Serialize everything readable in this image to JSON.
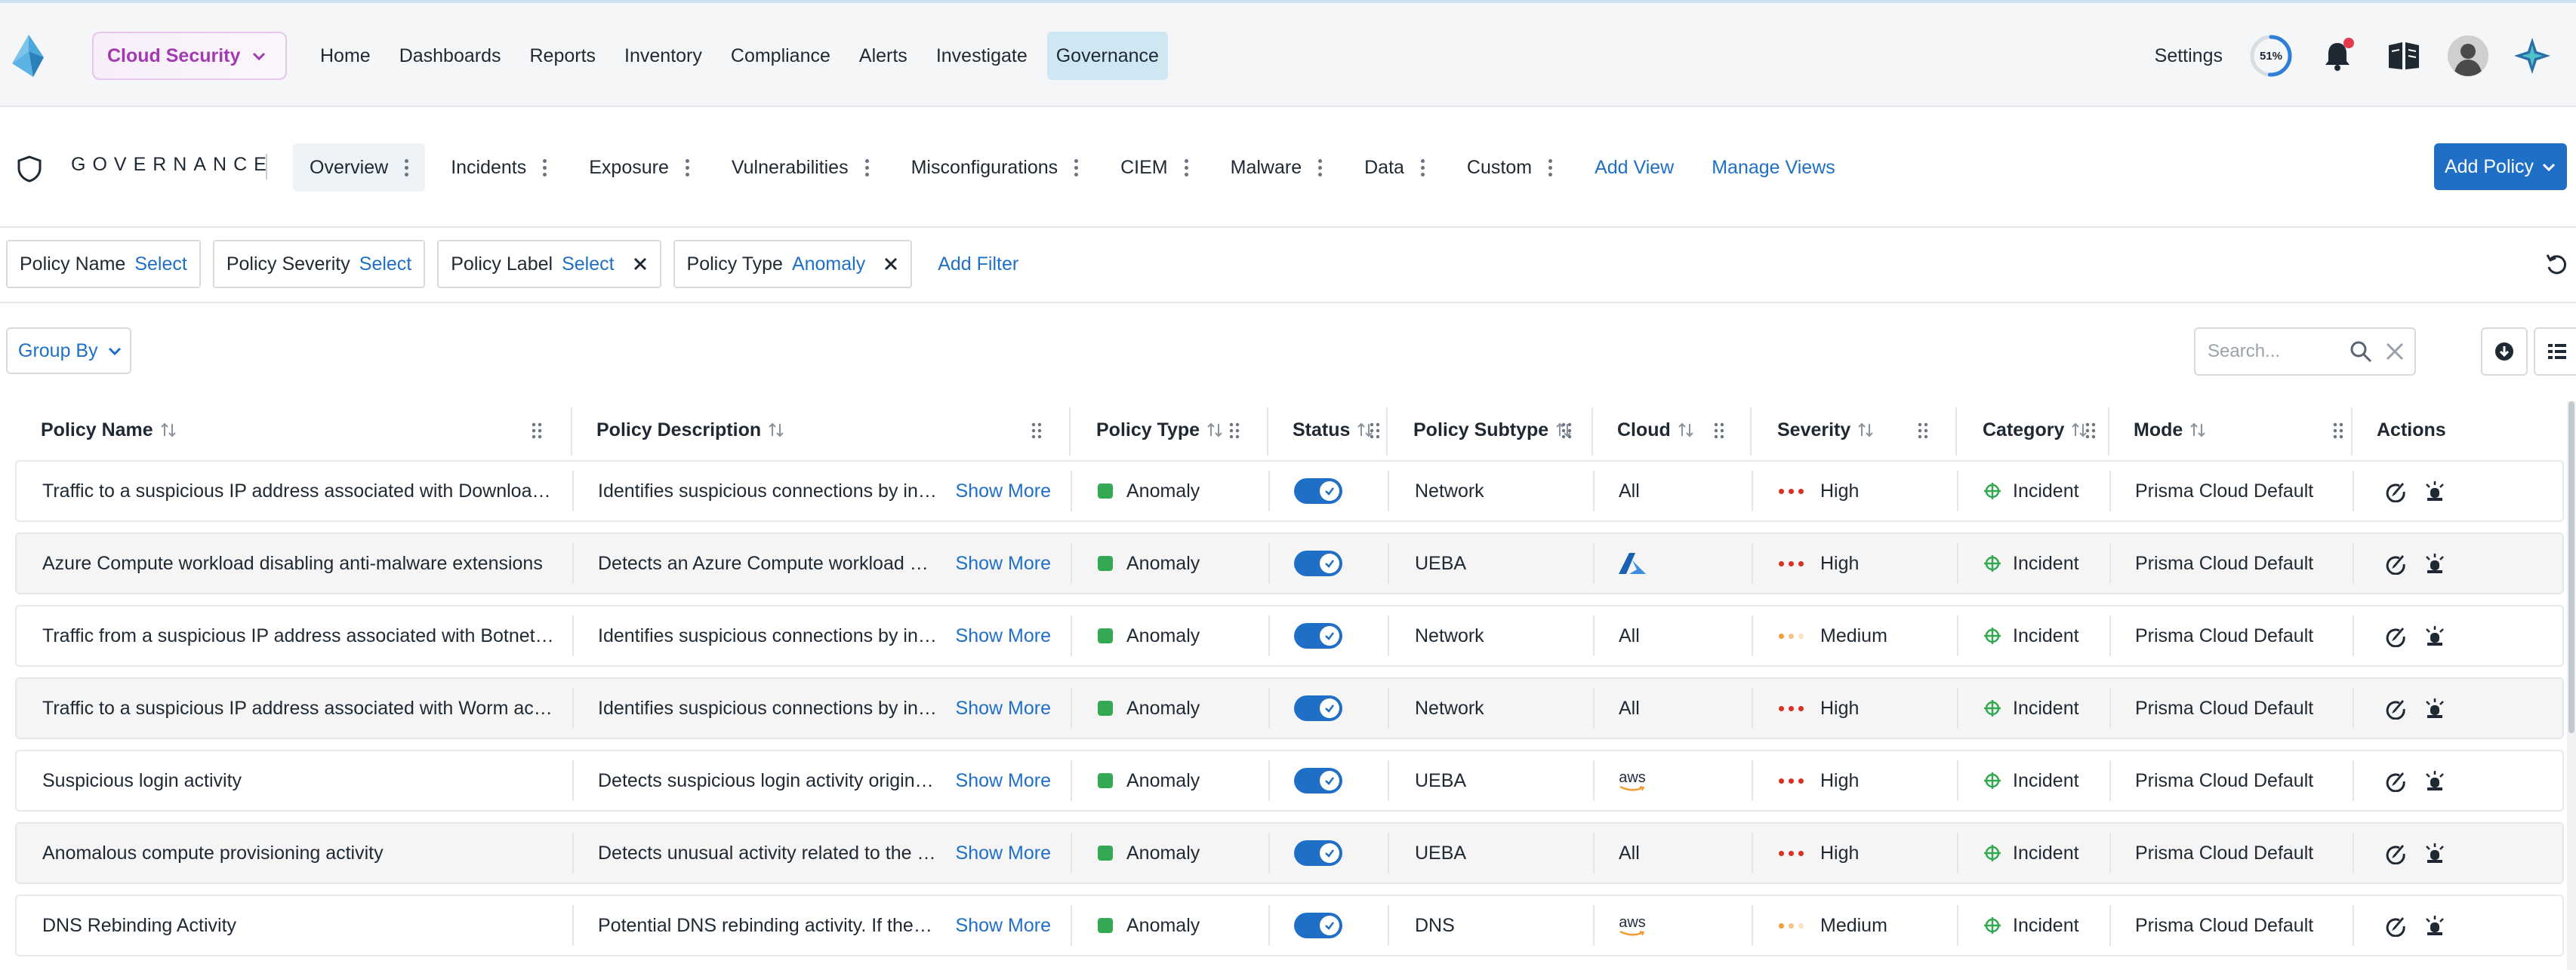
{
  "topnav": {
    "product": "Cloud Security",
    "links": [
      "Home",
      "Dashboards",
      "Reports",
      "Inventory",
      "Compliance",
      "Alerts",
      "Investigate",
      "Governance"
    ],
    "active_link": "Governance",
    "settings": "Settings",
    "progress_label": "51%",
    "progress_value": 0.51,
    "icons": [
      "bell-icon",
      "book-icon",
      "avatar",
      "assistant-icon"
    ]
  },
  "subnav": {
    "title": "GOVERNANCE",
    "tabs": [
      "Overview",
      "Incidents",
      "Exposure",
      "Vulnerabilities",
      "Misconfigurations",
      "CIEM",
      "Malware",
      "Data",
      "Custom"
    ],
    "active_tab": "Overview",
    "add_view": "Add View",
    "manage_views": "Manage Views",
    "add_policy": "Add Policy"
  },
  "filters": [
    {
      "label": "Policy Name",
      "value": "Select",
      "removable": false
    },
    {
      "label": "Policy Severity",
      "value": "Select",
      "removable": false
    },
    {
      "label": "Policy Label",
      "value": "Select",
      "removable": true
    },
    {
      "label": "Policy Type",
      "value": "Anomaly",
      "removable": true
    }
  ],
  "add_filter": "Add Filter",
  "toolbar": {
    "group_by": "Group By",
    "search_placeholder": "Search..."
  },
  "table": {
    "columns": [
      "Policy Name",
      "Policy Description",
      "Policy Type",
      "Status",
      "Policy Subtype",
      "Cloud",
      "Severity",
      "Category",
      "Mode",
      "Actions"
    ],
    "show_more": "Show More",
    "rows": [
      {
        "name": "Traffic to a suspicious IP address associated with Downloader ...",
        "description": "Identifies suspicious connections by inspe...",
        "type": "Anomaly",
        "enabled": true,
        "subtype": "Network",
        "cloud": "All",
        "cloud_icon": null,
        "severity": "High",
        "category": "Incident",
        "mode": "Prisma Cloud Default"
      },
      {
        "name": "Azure Compute workload disabling anti-malware extensions",
        "description": "Detects an Azure Compute workload disa...",
        "type": "Anomaly",
        "enabled": true,
        "subtype": "UEBA",
        "cloud": "",
        "cloud_icon": "azure-icon",
        "severity": "High",
        "category": "Incident",
        "mode": "Prisma Cloud Default"
      },
      {
        "name": "Traffic from a suspicious IP address associated with Botnet acti...",
        "description": "Identifies suspicious connections by inspe...",
        "type": "Anomaly",
        "enabled": true,
        "subtype": "Network",
        "cloud": "All",
        "cloud_icon": null,
        "severity": "Medium",
        "category": "Incident",
        "mode": "Prisma Cloud Default"
      },
      {
        "name": "Traffic to a suspicious IP address associated with Worm activity",
        "description": "Identifies suspicious connections by inspe...",
        "type": "Anomaly",
        "enabled": true,
        "subtype": "Network",
        "cloud": "All",
        "cloud_icon": null,
        "severity": "High",
        "category": "Incident",
        "mode": "Prisma Cloud Default"
      },
      {
        "name": "Suspicious login activity",
        "description": "Detects suspicious login activity originatin...",
        "type": "Anomaly",
        "enabled": true,
        "subtype": "UEBA",
        "cloud": "aws",
        "cloud_icon": "aws-icon",
        "severity": "High",
        "category": "Incident",
        "mode": "Prisma Cloud Default"
      },
      {
        "name": "Anomalous compute provisioning activity",
        "description": "Detects unusual activity related to the pro...",
        "type": "Anomaly",
        "enabled": true,
        "subtype": "UEBA",
        "cloud": "All",
        "cloud_icon": null,
        "severity": "High",
        "category": "Incident",
        "mode": "Prisma Cloud Default"
      },
      {
        "name": "DNS Rebinding Activity",
        "description": "Potential DNS rebinding activity. If the Sou...",
        "type": "Anomaly",
        "enabled": true,
        "subtype": "DNS",
        "cloud": "aws",
        "cloud_icon": "aws-icon",
        "severity": "Medium",
        "category": "Incident",
        "mode": "Prisma Cloud Default"
      }
    ]
  },
  "colors": {
    "accent": "#1f6fc7",
    "product": "#a23bb0",
    "high": "#d93025",
    "medium": "#f29d38",
    "anomaly": "#34a853",
    "category": "#34a853"
  }
}
